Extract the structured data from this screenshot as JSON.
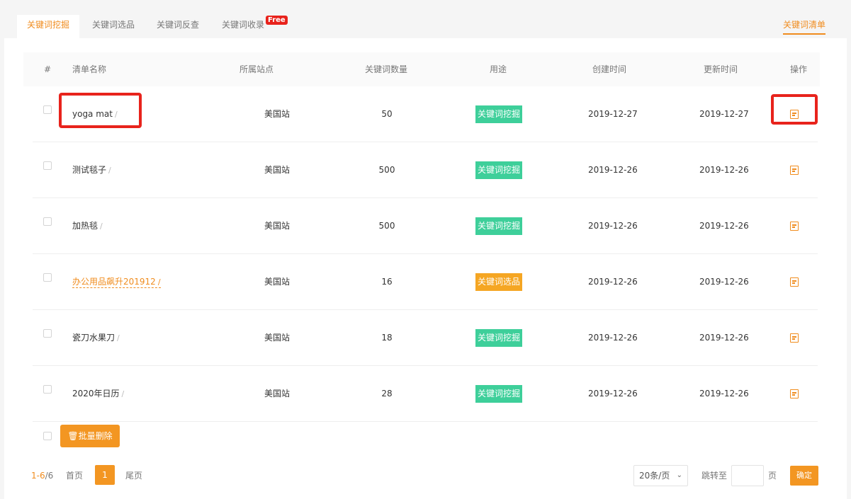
{
  "tabs": [
    {
      "label": "关键词挖掘"
    },
    {
      "label": "关键词选品"
    },
    {
      "label": "关键词反查"
    },
    {
      "label": "关键词收录",
      "badge": "Free"
    }
  ],
  "right_tab": "关键词清单",
  "table": {
    "headers": {
      "index": "#",
      "name": "清单名称",
      "site": "所属站点",
      "count": "关键词数量",
      "usage": "用途",
      "created": "创建时间",
      "updated": "更新时间",
      "action": "操作"
    },
    "rows": [
      {
        "name": "yoga mat",
        "site": "美国站",
        "count": "50",
        "usage": "关键词挖掘",
        "created": "2019-12-27",
        "updated": "2019-12-27"
      },
      {
        "name": "测试毯子",
        "site": "美国站",
        "count": "500",
        "usage": "关键词挖掘",
        "created": "2019-12-26",
        "updated": "2019-12-26"
      },
      {
        "name": "加热毯",
        "site": "美国站",
        "count": "500",
        "usage": "关键词挖掘",
        "created": "2019-12-26",
        "updated": "2019-12-26"
      },
      {
        "name": "办公用品飙升201912",
        "site": "美国站",
        "count": "16",
        "usage": "关键词选品",
        "created": "2019-12-26",
        "updated": "2019-12-26"
      },
      {
        "name": "瓷刀水果刀",
        "site": "美国站",
        "count": "18",
        "usage": "关键词挖掘",
        "created": "2019-12-26",
        "updated": "2019-12-26"
      },
      {
        "name": "2020年日历",
        "site": "美国站",
        "count": "28",
        "usage": "关键词挖掘",
        "created": "2019-12-26",
        "updated": "2019-12-26"
      }
    ]
  },
  "bulk_delete_label": "批量删除",
  "pagination": {
    "range": "1-6",
    "total": "/6",
    "first": "首页",
    "current": "1",
    "last": "尾页",
    "page_size": "20条/页",
    "jump_label": "跳转至",
    "page_unit": "页",
    "confirm": "确定"
  },
  "colors": {
    "accent": "#f08c1e",
    "usage_mining": "#3ecf9a",
    "usage_selection": "#f5a623",
    "highlight": "#e8231c"
  }
}
